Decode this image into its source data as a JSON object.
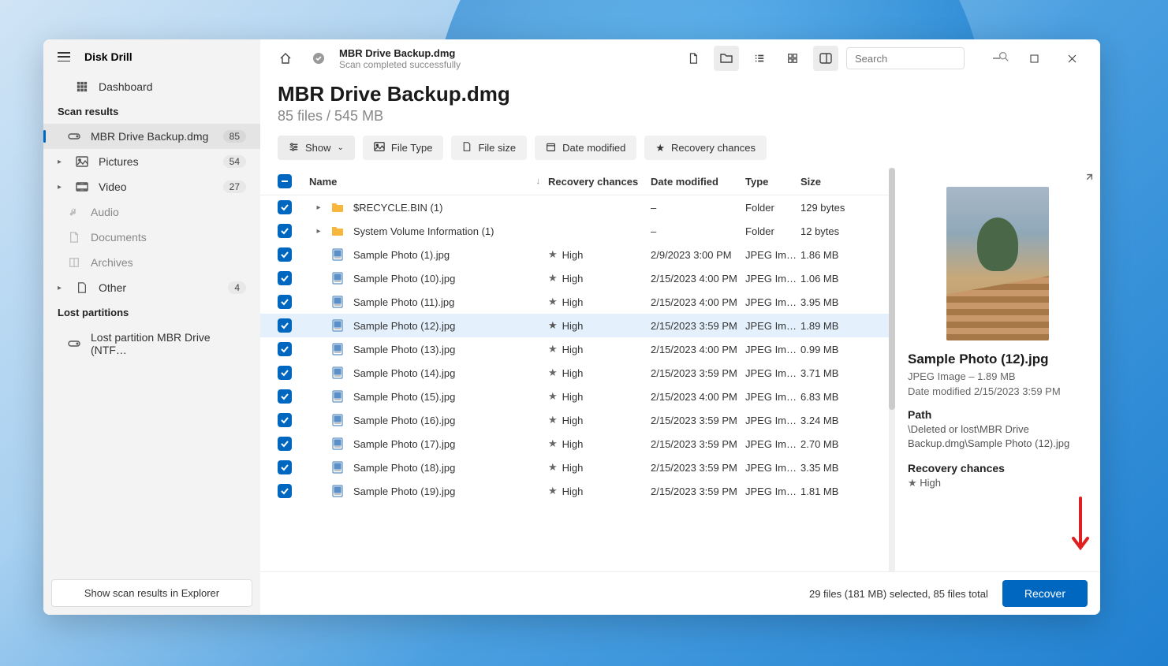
{
  "app": {
    "title": "Disk Drill"
  },
  "sidebar": {
    "dashboard": "Dashboard",
    "scan_results_label": "Scan results",
    "lost_partitions_label": "Lost partitions",
    "items": [
      {
        "label": "MBR Drive Backup.dmg",
        "badge": "85"
      },
      {
        "label": "Pictures",
        "badge": "54"
      },
      {
        "label": "Video",
        "badge": "27"
      },
      {
        "label": "Audio",
        "badge": ""
      },
      {
        "label": "Documents",
        "badge": ""
      },
      {
        "label": "Archives",
        "badge": ""
      },
      {
        "label": "Other",
        "badge": "4"
      }
    ],
    "lost_partition": "Lost partition MBR Drive (NTF…",
    "explorer_btn": "Show scan results in Explorer"
  },
  "breadcrumb": {
    "title": "MBR Drive Backup.dmg",
    "subtitle": "Scan completed successfully"
  },
  "search": {
    "placeholder": "Search"
  },
  "page": {
    "title": "MBR Drive Backup.dmg",
    "subtitle": "85 files / 545 MB"
  },
  "filters": {
    "show": "Show",
    "file_type": "File Type",
    "file_size": "File size",
    "date_modified": "Date modified",
    "recovery_chances": "Recovery chances"
  },
  "columns": {
    "name": "Name",
    "recovery": "Recovery chances",
    "date": "Date modified",
    "type": "Type",
    "size": "Size"
  },
  "rows": [
    {
      "kind": "folder",
      "name": "$RECYCLE.BIN (1)",
      "rec": "",
      "date": "–",
      "type": "Folder",
      "size": "129 bytes"
    },
    {
      "kind": "folder",
      "name": "System Volume Information (1)",
      "rec": "",
      "date": "–",
      "type": "Folder",
      "size": "12 bytes"
    },
    {
      "kind": "file",
      "name": "Sample Photo (1).jpg",
      "rec": "High",
      "date": "2/9/2023 3:00 PM",
      "type": "JPEG Im…",
      "size": "1.86 MB"
    },
    {
      "kind": "file",
      "name": "Sample Photo (10).jpg",
      "rec": "High",
      "date": "2/15/2023 4:00 PM",
      "type": "JPEG Im…",
      "size": "1.06 MB"
    },
    {
      "kind": "file",
      "name": "Sample Photo (11).jpg",
      "rec": "High",
      "date": "2/15/2023 4:00 PM",
      "type": "JPEG Im…",
      "size": "3.95 MB"
    },
    {
      "kind": "file",
      "name": "Sample Photo (12).jpg",
      "rec": "High",
      "date": "2/15/2023 3:59 PM",
      "type": "JPEG Im…",
      "size": "1.89 MB",
      "selected": true
    },
    {
      "kind": "file",
      "name": "Sample Photo (13).jpg",
      "rec": "High",
      "date": "2/15/2023 4:00 PM",
      "type": "JPEG Im…",
      "size": "0.99 MB"
    },
    {
      "kind": "file",
      "name": "Sample Photo (14).jpg",
      "rec": "High",
      "date": "2/15/2023 3:59 PM",
      "type": "JPEG Im…",
      "size": "3.71 MB"
    },
    {
      "kind": "file",
      "name": "Sample Photo (15).jpg",
      "rec": "High",
      "date": "2/15/2023 4:00 PM",
      "type": "JPEG Im…",
      "size": "6.83 MB"
    },
    {
      "kind": "file",
      "name": "Sample Photo (16).jpg",
      "rec": "High",
      "date": "2/15/2023 3:59 PM",
      "type": "JPEG Im…",
      "size": "3.24 MB"
    },
    {
      "kind": "file",
      "name": "Sample Photo (17).jpg",
      "rec": "High",
      "date": "2/15/2023 3:59 PM",
      "type": "JPEG Im…",
      "size": "2.70 MB"
    },
    {
      "kind": "file",
      "name": "Sample Photo (18).jpg",
      "rec": "High",
      "date": "2/15/2023 3:59 PM",
      "type": "JPEG Im…",
      "size": "3.35 MB"
    },
    {
      "kind": "file",
      "name": "Sample Photo (19).jpg",
      "rec": "High",
      "date": "2/15/2023 3:59 PM",
      "type": "JPEG Im…",
      "size": "1.81 MB"
    }
  ],
  "preview": {
    "title": "Sample Photo (12).jpg",
    "meta1": "JPEG Image – 1.89 MB",
    "meta2": "Date modified 2/15/2023 3:59 PM",
    "path_label": "Path",
    "path_value": "\\Deleted or lost\\MBR Drive Backup.dmg\\Sample Photo (12).jpg",
    "rec_label": "Recovery chances",
    "rec_value": "High"
  },
  "footer": {
    "status": "29 files (181 MB) selected, 85 files total",
    "recover": "Recover"
  }
}
